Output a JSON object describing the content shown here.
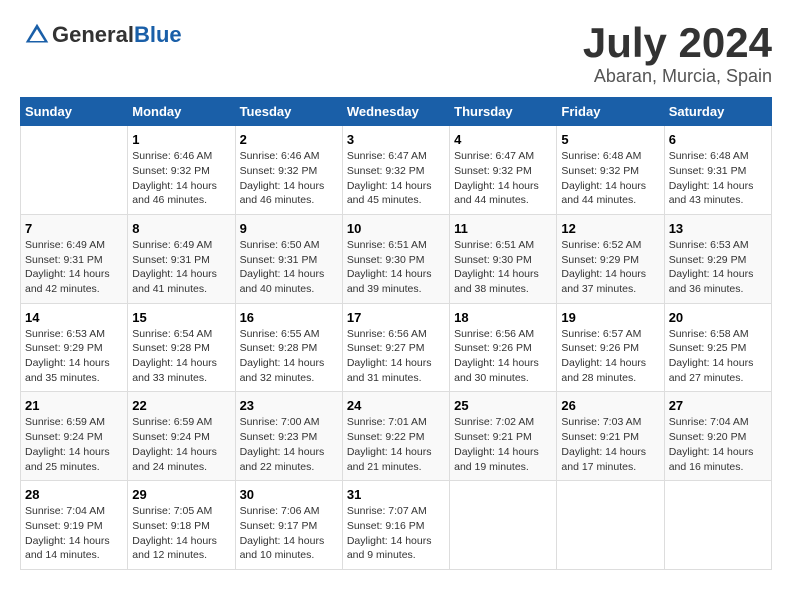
{
  "header": {
    "logo_general": "General",
    "logo_blue": "Blue",
    "month": "July 2024",
    "location": "Abaran, Murcia, Spain"
  },
  "days_of_week": [
    "Sunday",
    "Monday",
    "Tuesday",
    "Wednesday",
    "Thursday",
    "Friday",
    "Saturday"
  ],
  "weeks": [
    [
      {
        "day": "",
        "info": ""
      },
      {
        "day": "1",
        "info": "Sunrise: 6:46 AM\nSunset: 9:32 PM\nDaylight: 14 hours\nand 46 minutes."
      },
      {
        "day": "2",
        "info": "Sunrise: 6:46 AM\nSunset: 9:32 PM\nDaylight: 14 hours\nand 46 minutes."
      },
      {
        "day": "3",
        "info": "Sunrise: 6:47 AM\nSunset: 9:32 PM\nDaylight: 14 hours\nand 45 minutes."
      },
      {
        "day": "4",
        "info": "Sunrise: 6:47 AM\nSunset: 9:32 PM\nDaylight: 14 hours\nand 44 minutes."
      },
      {
        "day": "5",
        "info": "Sunrise: 6:48 AM\nSunset: 9:32 PM\nDaylight: 14 hours\nand 44 minutes."
      },
      {
        "day": "6",
        "info": "Sunrise: 6:48 AM\nSunset: 9:31 PM\nDaylight: 14 hours\nand 43 minutes."
      }
    ],
    [
      {
        "day": "7",
        "info": "Sunrise: 6:49 AM\nSunset: 9:31 PM\nDaylight: 14 hours\nand 42 minutes."
      },
      {
        "day": "8",
        "info": "Sunrise: 6:49 AM\nSunset: 9:31 PM\nDaylight: 14 hours\nand 41 minutes."
      },
      {
        "day": "9",
        "info": "Sunrise: 6:50 AM\nSunset: 9:31 PM\nDaylight: 14 hours\nand 40 minutes."
      },
      {
        "day": "10",
        "info": "Sunrise: 6:51 AM\nSunset: 9:30 PM\nDaylight: 14 hours\nand 39 minutes."
      },
      {
        "day": "11",
        "info": "Sunrise: 6:51 AM\nSunset: 9:30 PM\nDaylight: 14 hours\nand 38 minutes."
      },
      {
        "day": "12",
        "info": "Sunrise: 6:52 AM\nSunset: 9:29 PM\nDaylight: 14 hours\nand 37 minutes."
      },
      {
        "day": "13",
        "info": "Sunrise: 6:53 AM\nSunset: 9:29 PM\nDaylight: 14 hours\nand 36 minutes."
      }
    ],
    [
      {
        "day": "14",
        "info": "Sunrise: 6:53 AM\nSunset: 9:29 PM\nDaylight: 14 hours\nand 35 minutes."
      },
      {
        "day": "15",
        "info": "Sunrise: 6:54 AM\nSunset: 9:28 PM\nDaylight: 14 hours\nand 33 minutes."
      },
      {
        "day": "16",
        "info": "Sunrise: 6:55 AM\nSunset: 9:28 PM\nDaylight: 14 hours\nand 32 minutes."
      },
      {
        "day": "17",
        "info": "Sunrise: 6:56 AM\nSunset: 9:27 PM\nDaylight: 14 hours\nand 31 minutes."
      },
      {
        "day": "18",
        "info": "Sunrise: 6:56 AM\nSunset: 9:26 PM\nDaylight: 14 hours\nand 30 minutes."
      },
      {
        "day": "19",
        "info": "Sunrise: 6:57 AM\nSunset: 9:26 PM\nDaylight: 14 hours\nand 28 minutes."
      },
      {
        "day": "20",
        "info": "Sunrise: 6:58 AM\nSunset: 9:25 PM\nDaylight: 14 hours\nand 27 minutes."
      }
    ],
    [
      {
        "day": "21",
        "info": "Sunrise: 6:59 AM\nSunset: 9:24 PM\nDaylight: 14 hours\nand 25 minutes."
      },
      {
        "day": "22",
        "info": "Sunrise: 6:59 AM\nSunset: 9:24 PM\nDaylight: 14 hours\nand 24 minutes."
      },
      {
        "day": "23",
        "info": "Sunrise: 7:00 AM\nSunset: 9:23 PM\nDaylight: 14 hours\nand 22 minutes."
      },
      {
        "day": "24",
        "info": "Sunrise: 7:01 AM\nSunset: 9:22 PM\nDaylight: 14 hours\nand 21 minutes."
      },
      {
        "day": "25",
        "info": "Sunrise: 7:02 AM\nSunset: 9:21 PM\nDaylight: 14 hours\nand 19 minutes."
      },
      {
        "day": "26",
        "info": "Sunrise: 7:03 AM\nSunset: 9:21 PM\nDaylight: 14 hours\nand 17 minutes."
      },
      {
        "day": "27",
        "info": "Sunrise: 7:04 AM\nSunset: 9:20 PM\nDaylight: 14 hours\nand 16 minutes."
      }
    ],
    [
      {
        "day": "28",
        "info": "Sunrise: 7:04 AM\nSunset: 9:19 PM\nDaylight: 14 hours\nand 14 minutes."
      },
      {
        "day": "29",
        "info": "Sunrise: 7:05 AM\nSunset: 9:18 PM\nDaylight: 14 hours\nand 12 minutes."
      },
      {
        "day": "30",
        "info": "Sunrise: 7:06 AM\nSunset: 9:17 PM\nDaylight: 14 hours\nand 10 minutes."
      },
      {
        "day": "31",
        "info": "Sunrise: 7:07 AM\nSunset: 9:16 PM\nDaylight: 14 hours\nand 9 minutes."
      },
      {
        "day": "",
        "info": ""
      },
      {
        "day": "",
        "info": ""
      },
      {
        "day": "",
        "info": ""
      }
    ]
  ]
}
